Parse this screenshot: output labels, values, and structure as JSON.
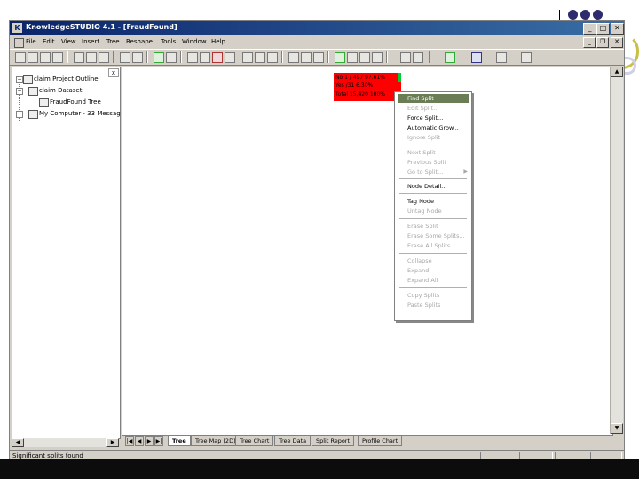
{
  "window": {
    "title": "KnowledgeSTUDIO 4.1 - [FraudFound]",
    "controls": {
      "minimize": "_",
      "maximize": "□",
      "close": "✕"
    }
  },
  "menu": [
    "File",
    "Edit",
    "View",
    "Insert",
    "Tree",
    "Reshape",
    "Tools",
    "Window",
    "Help"
  ],
  "mdi_controls": {
    "minimize": "_",
    "restore": "❐",
    "close": "✕"
  },
  "left_pane": {
    "close_glyph": "x",
    "items": [
      {
        "label": "claim Project Outline",
        "expander": "−"
      },
      {
        "label": "claim Dataset",
        "expander": "−"
      },
      {
        "label": "FraudFound Tree",
        "expander": ""
      },
      {
        "label": "My Computer - 33 Messag",
        "expander": "−"
      }
    ]
  },
  "node": {
    "lines": [
      "No   1 / 497   97.61%",
      "Yes    /31      6.30%",
      "Total 15,420 100%"
    ],
    "colors": {
      "fill": "#ff0000",
      "marker": "#00cc33"
    }
  },
  "context_menu": {
    "items": [
      {
        "label": "Find Split",
        "state": "selected"
      },
      {
        "label": "Edit Split...",
        "state": "disabled"
      },
      {
        "label": "Force Split...",
        "state": "enabled"
      },
      {
        "label": "Automatic Grow...",
        "state": "enabled"
      },
      {
        "label": "Ignore Split",
        "state": "disabled"
      },
      {
        "label": "Next Split",
        "state": "disabled"
      },
      {
        "label": "Previous Split",
        "state": "disabled"
      },
      {
        "label": "Go to Split...",
        "state": "disabled",
        "submenu": "▶"
      },
      {
        "label": "Node Detail...",
        "state": "enabled"
      },
      {
        "label": "Tag Node",
        "state": "enabled"
      },
      {
        "label": "Untag Node",
        "state": "disabled"
      },
      {
        "label": "Erase Split",
        "state": "disabled"
      },
      {
        "label": "Erase Some Splits...",
        "state": "disabled"
      },
      {
        "label": "Erase All Splits",
        "state": "disabled"
      },
      {
        "label": "Collapse",
        "state": "disabled"
      },
      {
        "label": "Expand",
        "state": "disabled"
      },
      {
        "label": "Expand All",
        "state": "disabled"
      },
      {
        "label": "Copy Splits",
        "state": "disabled"
      },
      {
        "label": "Paste Splits",
        "state": "disabled"
      }
    ],
    "highlight_color": "#6b7d54"
  },
  "tabs": {
    "nav": [
      "|◀",
      "◀",
      "▶",
      "▶|"
    ],
    "items": [
      "Tree",
      "Tree Map (2D)",
      "Tree Chart",
      "Tree Data",
      "Split Report",
      "Profile Chart"
    ],
    "active": "Tree"
  },
  "status": {
    "text": "Significant splits found"
  },
  "scroll": {
    "left": "◀",
    "right": "▶",
    "up": "▲",
    "down": "▼"
  },
  "icons": [
    "new-icon",
    "open-icon",
    "save-icon",
    "print-icon",
    "cut-icon",
    "copy-icon",
    "paste-icon",
    "help-icon",
    "context-help-icon",
    "tree-icon",
    "filter-icon",
    "grow-icon",
    "split-icon",
    "prune-icon",
    "run-icon",
    "zoom-icon",
    "chart-icon",
    "report-icon",
    "stop-icon"
  ]
}
